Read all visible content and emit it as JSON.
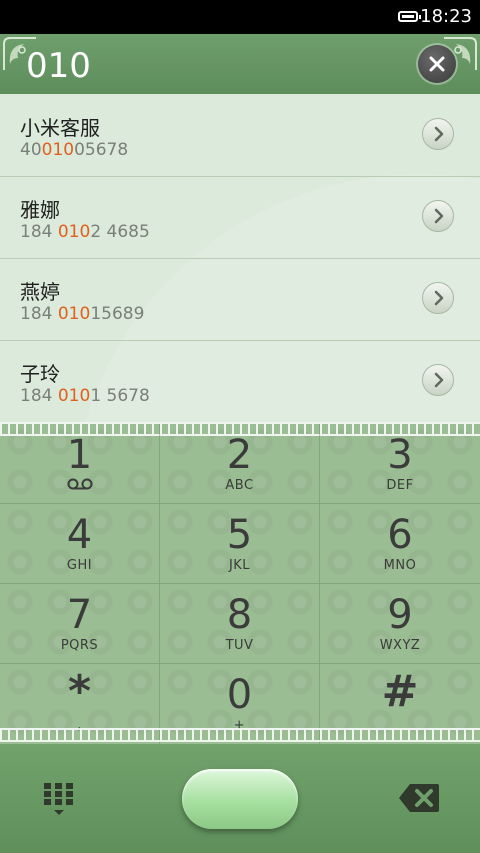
{
  "status_bar": {
    "time": "18:23"
  },
  "header": {
    "dialed_number": "010"
  },
  "suggestions": [
    {
      "name": "小米客服",
      "number_pre": "40",
      "number_match": "010",
      "number_post": "05678"
    },
    {
      "name": "雅娜",
      "number_pre": "184 ",
      "number_match": "010",
      "number_post": "2 4685"
    },
    {
      "name": "燕婷",
      "number_pre": "184 ",
      "number_match": "010",
      "number_post": "15689"
    },
    {
      "name": "子玲",
      "number_pre": "184 ",
      "number_match": "010",
      "number_post": "1 5678"
    }
  ],
  "keypad": [
    {
      "digit": "1",
      "letters": ""
    },
    {
      "digit": "2",
      "letters": "ABC"
    },
    {
      "digit": "3",
      "letters": "DEF"
    },
    {
      "digit": "4",
      "letters": "GHI"
    },
    {
      "digit": "5",
      "letters": "JKL"
    },
    {
      "digit": "6",
      "letters": "MNO"
    },
    {
      "digit": "7",
      "letters": "PQRS"
    },
    {
      "digit": "8",
      "letters": "TUV"
    },
    {
      "digit": "9",
      "letters": "WXYZ"
    },
    {
      "digit": "*",
      "letters": ","
    },
    {
      "digit": "0",
      "letters": "+"
    },
    {
      "digit": "#",
      "letters": ""
    }
  ],
  "colors": {
    "header": "#6a9b67",
    "highlight": "#e0601c",
    "keypad_bg": "#9bbd94",
    "call_button": "#a6e0a0"
  },
  "icons": {
    "battery": "battery-icon",
    "clear": "close-icon",
    "arrow": "chevron-right-icon",
    "voicemail": "voicemail-icon",
    "dialpad": "dialpad-icon",
    "backspace": "backspace-icon"
  }
}
